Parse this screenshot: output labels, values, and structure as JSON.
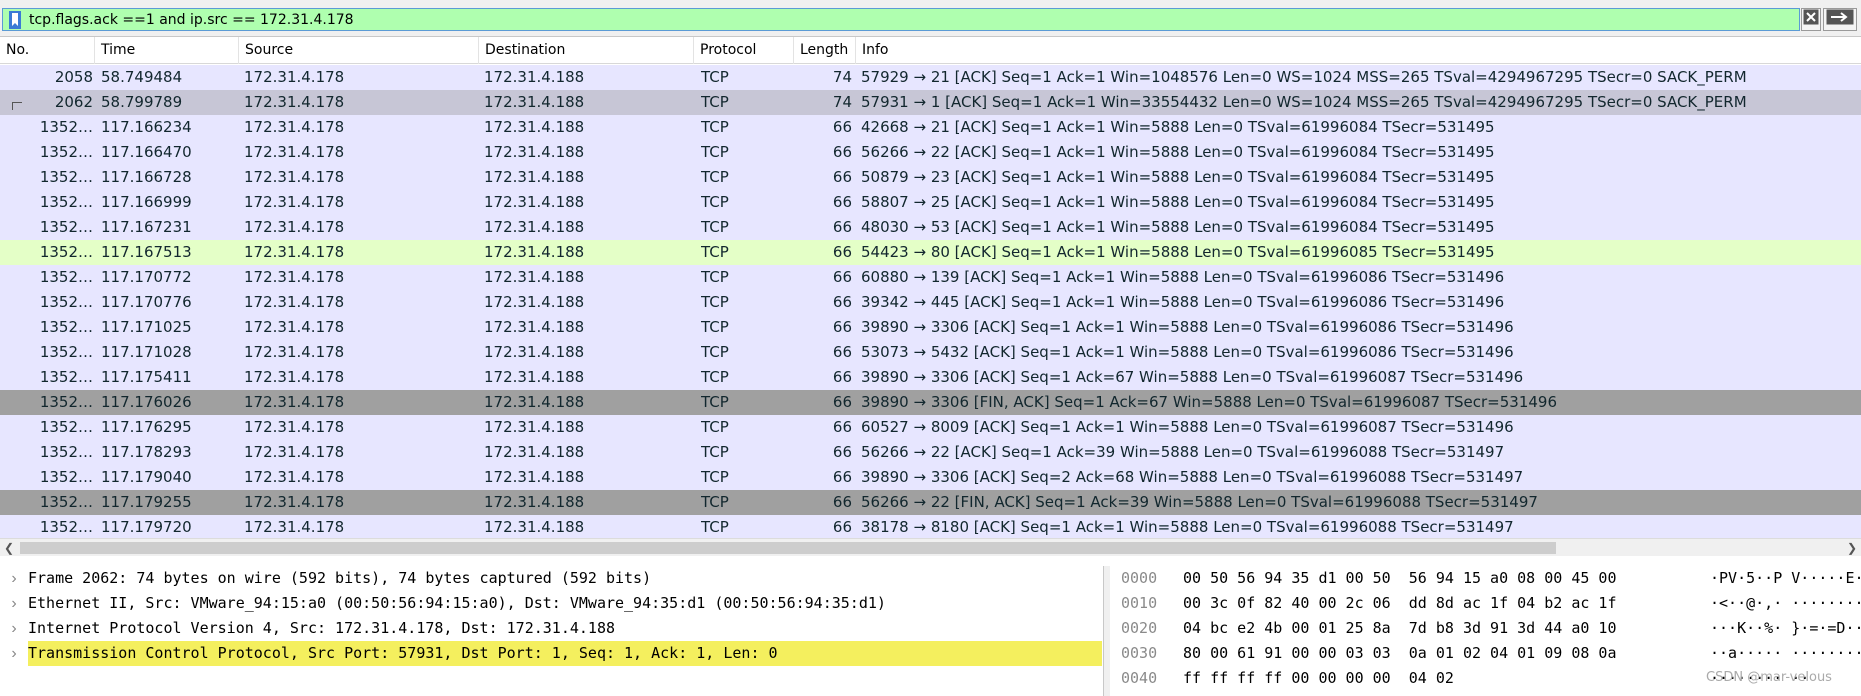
{
  "filter": {
    "text": "tcp.flags.ack ==1 and ip.src == 172.31.4.178",
    "bookmark_icon": "bookmark-icon",
    "clear_icon": "close-icon",
    "apply_icon": "arrow-right-icon"
  },
  "columns": {
    "no": "No.",
    "time": "Time",
    "source": "Source",
    "destination": "Destination",
    "protocol": "Protocol",
    "length": "Length",
    "info": "Info"
  },
  "packets": [
    {
      "no": "2058",
      "time": "58.749484",
      "source": "172.31.4.178",
      "destination": "172.31.4.188",
      "protocol": "TCP",
      "length": "74",
      "info": "57929 → 21 [ACK] Seq=1 Ack=1 Win=1048576 Len=0 WS=1024 MSS=265 TSval=4294967295 TSecr=0 SACK_PERM",
      "style": "normal"
    },
    {
      "no": "2062",
      "time": "58.799789",
      "source": "172.31.4.178",
      "destination": "172.31.4.188",
      "protocol": "TCP",
      "length": "74",
      "info": "57931 → 1 [ACK] Seq=1 Ack=1 Win=33554432 Len=0 WS=1024 MSS=265 TSval=4294967295 TSecr=0 SACK_PERM",
      "style": "selected"
    },
    {
      "no": "1352…",
      "time": "117.166234",
      "source": "172.31.4.178",
      "destination": "172.31.4.188",
      "protocol": "TCP",
      "length": "66",
      "info": "42668 → 21 [ACK] Seq=1 Ack=1 Win=5888 Len=0 TSval=61996084 TSecr=531495",
      "style": "normal"
    },
    {
      "no": "1352…",
      "time": "117.166470",
      "source": "172.31.4.178",
      "destination": "172.31.4.188",
      "protocol": "TCP",
      "length": "66",
      "info": "56266 → 22 [ACK] Seq=1 Ack=1 Win=5888 Len=0 TSval=61996084 TSecr=531495",
      "style": "normal"
    },
    {
      "no": "1352…",
      "time": "117.166728",
      "source": "172.31.4.178",
      "destination": "172.31.4.188",
      "protocol": "TCP",
      "length": "66",
      "info": "50879 → 23 [ACK] Seq=1 Ack=1 Win=5888 Len=0 TSval=61996084 TSecr=531495",
      "style": "normal"
    },
    {
      "no": "1352…",
      "time": "117.166999",
      "source": "172.31.4.178",
      "destination": "172.31.4.188",
      "protocol": "TCP",
      "length": "66",
      "info": "58807 → 25 [ACK] Seq=1 Ack=1 Win=5888 Len=0 TSval=61996084 TSecr=531495",
      "style": "normal"
    },
    {
      "no": "1352…",
      "time": "117.167231",
      "source": "172.31.4.178",
      "destination": "172.31.4.188",
      "protocol": "TCP",
      "length": "66",
      "info": "48030 → 53 [ACK] Seq=1 Ack=1 Win=5888 Len=0 TSval=61996084 TSecr=531495",
      "style": "normal"
    },
    {
      "no": "1352…",
      "time": "117.167513",
      "source": "172.31.4.178",
      "destination": "172.31.4.188",
      "protocol": "TCP",
      "length": "66",
      "info": "54423 → 80 [ACK] Seq=1 Ack=1 Win=5888 Len=0 TSval=61996085 TSecr=531495",
      "style": "http"
    },
    {
      "no": "1352…",
      "time": "117.170772",
      "source": "172.31.4.178",
      "destination": "172.31.4.188",
      "protocol": "TCP",
      "length": "66",
      "info": "60880 → 139 [ACK] Seq=1 Ack=1 Win=5888 Len=0 TSval=61996086 TSecr=531496",
      "style": "normal"
    },
    {
      "no": "1352…",
      "time": "117.170776",
      "source": "172.31.4.178",
      "destination": "172.31.4.188",
      "protocol": "TCP",
      "length": "66",
      "info": "39342 → 445 [ACK] Seq=1 Ack=1 Win=5888 Len=0 TSval=61996086 TSecr=531496",
      "style": "normal"
    },
    {
      "no": "1352…",
      "time": "117.171025",
      "source": "172.31.4.178",
      "destination": "172.31.4.188",
      "protocol": "TCP",
      "length": "66",
      "info": "39890 → 3306 [ACK] Seq=1 Ack=1 Win=5888 Len=0 TSval=61996086 TSecr=531496",
      "style": "normal"
    },
    {
      "no": "1352…",
      "time": "117.171028",
      "source": "172.31.4.178",
      "destination": "172.31.4.188",
      "protocol": "TCP",
      "length": "66",
      "info": "53073 → 5432 [ACK] Seq=1 Ack=1 Win=5888 Len=0 TSval=61996086 TSecr=531496",
      "style": "normal"
    },
    {
      "no": "1352…",
      "time": "117.175411",
      "source": "172.31.4.178",
      "destination": "172.31.4.188",
      "protocol": "TCP",
      "length": "66",
      "info": "39890 → 3306 [ACK] Seq=1 Ack=67 Win=5888 Len=0 TSval=61996087 TSecr=531496",
      "style": "normal"
    },
    {
      "no": "1352…",
      "time": "117.176026",
      "source": "172.31.4.178",
      "destination": "172.31.4.188",
      "protocol": "TCP",
      "length": "66",
      "info": "39890 → 3306 [FIN, ACK] Seq=1 Ack=67 Win=5888 Len=0 TSval=61996087 TSecr=531496",
      "style": "fin"
    },
    {
      "no": "1352…",
      "time": "117.176295",
      "source": "172.31.4.178",
      "destination": "172.31.4.188",
      "protocol": "TCP",
      "length": "66",
      "info": "60527 → 8009 [ACK] Seq=1 Ack=1 Win=5888 Len=0 TSval=61996087 TSecr=531496",
      "style": "normal"
    },
    {
      "no": "1352…",
      "time": "117.178293",
      "source": "172.31.4.178",
      "destination": "172.31.4.188",
      "protocol": "TCP",
      "length": "66",
      "info": "56266 → 22 [ACK] Seq=1 Ack=39 Win=5888 Len=0 TSval=61996088 TSecr=531497",
      "style": "normal"
    },
    {
      "no": "1352…",
      "time": "117.179040",
      "source": "172.31.4.178",
      "destination": "172.31.4.188",
      "protocol": "TCP",
      "length": "66",
      "info": "39890 → 3306 [ACK] Seq=2 Ack=68 Win=5888 Len=0 TSval=61996088 TSecr=531497",
      "style": "normal"
    },
    {
      "no": "1352…",
      "time": "117.179255",
      "source": "172.31.4.178",
      "destination": "172.31.4.188",
      "protocol": "TCP",
      "length": "66",
      "info": "56266 → 22 [FIN, ACK] Seq=1 Ack=39 Win=5888 Len=0 TSval=61996088 TSecr=531497",
      "style": "fin"
    },
    {
      "no": "1352…",
      "time": "117.179720",
      "source": "172.31.4.178",
      "destination": "172.31.4.188",
      "protocol": "TCP",
      "length": "66",
      "info": "38178 → 8180 [ACK] Seq=1 Ack=1 Win=5888 Len=0 TSval=61996088 TSecr=531497",
      "style": "normal"
    }
  ],
  "details": [
    {
      "text": "Frame 2062: 74 bytes on wire (592 bits), 74 bytes captured (592 bits)",
      "highlighted": false
    },
    {
      "text": "Ethernet II, Src: VMware_94:15:a0 (00:50:56:94:15:a0), Dst: VMware_94:35:d1 (00:50:56:94:35:d1)",
      "highlighted": false
    },
    {
      "text": "Internet Protocol Version 4, Src: 172.31.4.178, Dst: 172.31.4.188",
      "highlighted": false
    },
    {
      "text": "Transmission Control Protocol, Src Port: 57931, Dst Port: 1, Seq: 1, Ack: 1, Len: 0",
      "highlighted": true
    }
  ],
  "bytes": [
    {
      "offset": "0000",
      "hex": "00 50 56 94 35 d1 00 50  56 94 15 a0 08 00 45 00",
      "ascii": "·PV·5··P V·····E·"
    },
    {
      "offset": "0010",
      "hex": "00 3c 0f 82 40 00 2c 06  dd 8d ac 1f 04 b2 ac 1f",
      "ascii": "·<··@·,· ········"
    },
    {
      "offset": "0020",
      "hex": "04 bc e2 4b 00 01 25 8a  7d b8 3d 91 3d 44 a0 10",
      "ascii": "···K··%· }·=·=D··"
    },
    {
      "offset": "0030",
      "hex": "80 00 61 91 00 00 03 03  0a 01 02 04 01 09 08 0a",
      "ascii": "··a····· ········"
    },
    {
      "offset": "0040",
      "hex": "ff ff ff ff 00 00 00 00  04 02",
      "ascii": "········ ··"
    }
  ],
  "watermark": "CSDN @mar-velous",
  "colors": {
    "filter_valid_bg": "#afffaf",
    "tcp_row_bg": "#e7e6ff",
    "selected_row_bg": "#c7c6d6",
    "http_row_bg": "#e4ffc7",
    "fin_row_bg": "#a0a0a0",
    "detail_highlight_bg": "#f4ef5e"
  }
}
